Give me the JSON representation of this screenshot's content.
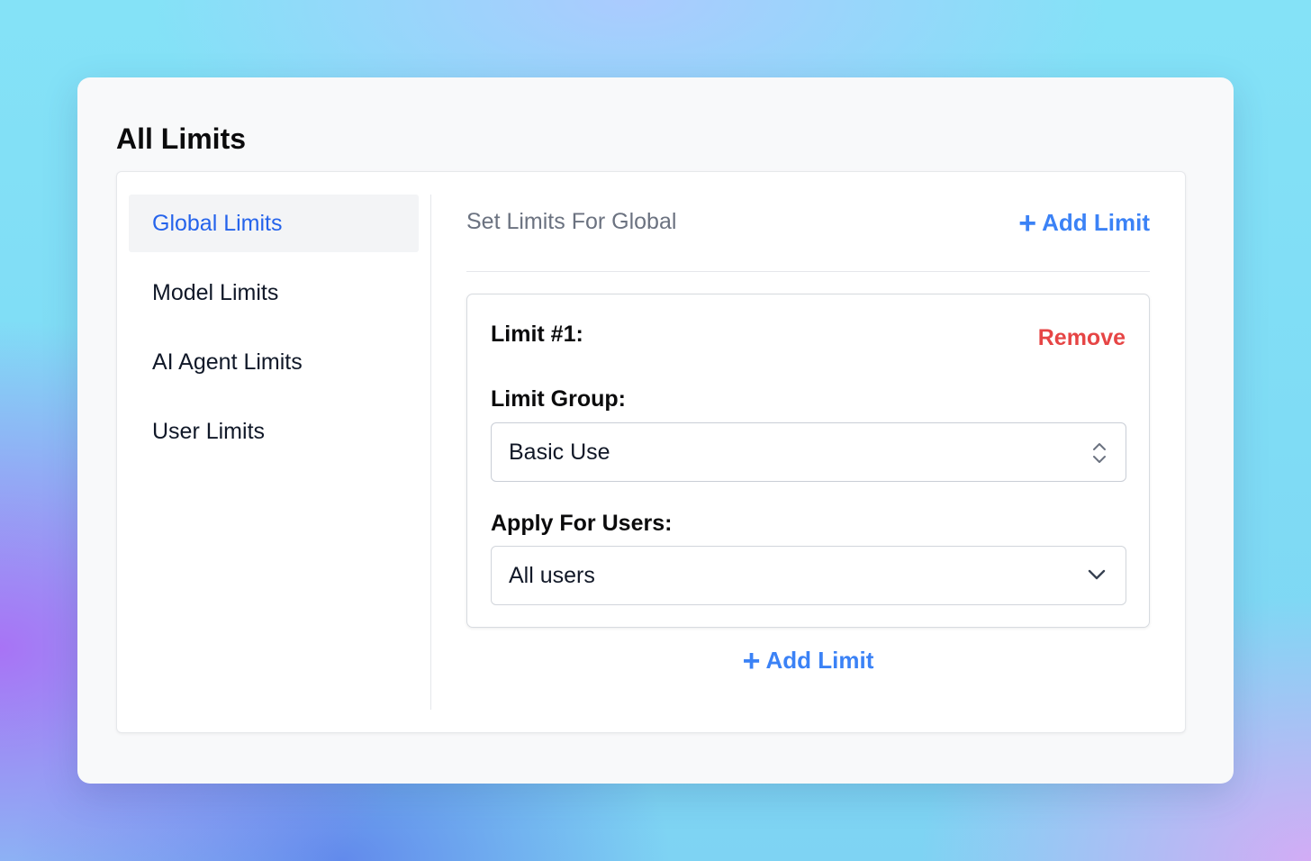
{
  "page": {
    "title": "All Limits"
  },
  "sidebar": {
    "items": [
      {
        "label": "Global Limits",
        "active": true
      },
      {
        "label": "Model Limits",
        "active": false
      },
      {
        "label": "AI Agent Limits",
        "active": false
      },
      {
        "label": "User Limits",
        "active": false
      }
    ]
  },
  "content": {
    "title": "Set Limits For Global",
    "add_limit_label": "Add Limit",
    "add_limit_bottom_label": "Add Limit"
  },
  "limit_card": {
    "title": "Limit #1:",
    "remove_label": "Remove",
    "limit_group_label": "Limit Group:",
    "limit_group_value": "Basic Use",
    "apply_users_label": "Apply For Users:",
    "apply_users_value": "All users"
  },
  "icons": {
    "add": "plus-icon",
    "limit_group_select": "up-down-chevron-icon",
    "apply_users_select": "chevron-down-icon"
  },
  "colors": {
    "accent": "#3b82f6",
    "active_link": "#2563eb",
    "danger": "#e64545",
    "muted_text": "#6b7280"
  }
}
